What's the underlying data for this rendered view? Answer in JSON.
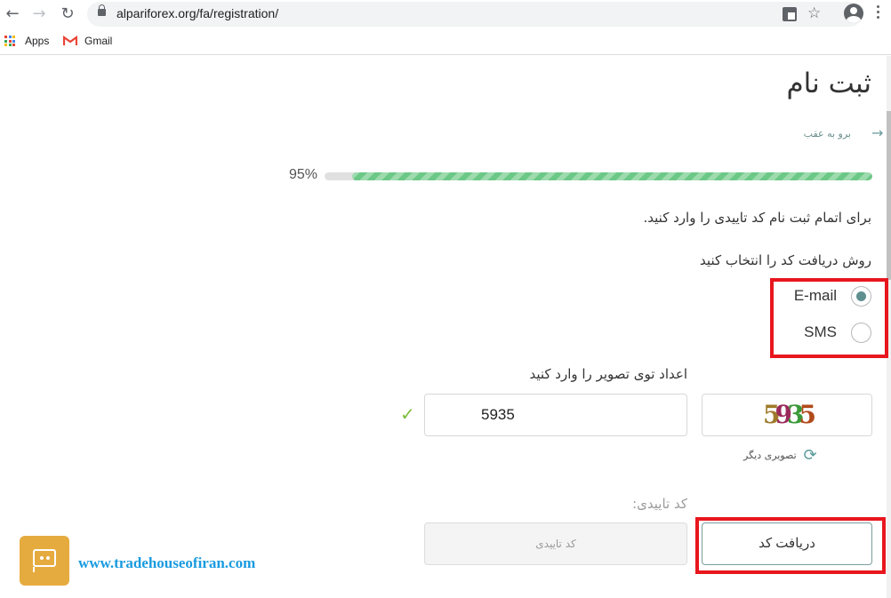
{
  "browser": {
    "url": "alpariforex.org/fa/registration/",
    "bookmarks": [
      {
        "label": "Apps",
        "icon": "apps-grid-icon"
      },
      {
        "label": "Gmail",
        "icon": "gmail-icon"
      }
    ],
    "icons": {
      "back": "←",
      "forward": "→",
      "reload": "↻",
      "star": "☆"
    }
  },
  "page": {
    "title": "ثبت نام",
    "back_link": "برو به عقب",
    "back_arrow": "→",
    "progress": {
      "label": "95%",
      "percent": 95,
      "colors": {
        "stripe_dark": "#6cc886",
        "stripe_light": "#9ddbae",
        "track": "#e0e0e0"
      }
    },
    "instruction": "برای اتمام ثبت نام کد تاییدی را وارد کنید.",
    "method_label": "روش دریافت کد را انتخاب کنید",
    "methods": [
      {
        "label": "E-mail",
        "checked": true
      },
      {
        "label": "SMS",
        "checked": false
      }
    ],
    "captcha": {
      "label": "اعداد توی تصویر را وارد کنید",
      "input_value": "5935",
      "valid_icon": "✓",
      "image_digits": [
        {
          "char": "5",
          "color": "#a07a2a"
        },
        {
          "char": "9",
          "color": "#9a2a5a"
        },
        {
          "char": "3",
          "color": "#3a9a3a"
        },
        {
          "char": "5",
          "color": "#b04a1a"
        }
      ],
      "refresh_label": "تصویری دیگر",
      "refresh_icon": "⟳"
    },
    "verification": {
      "label": "کد تاییدی:",
      "placeholder": "کد تاییدی",
      "get_code_button": "دریافت کد"
    }
  },
  "overlay": {
    "watermark": "www.tradehouseofiran.com",
    "highlight_color": "#e8161d",
    "chat_color": "#e6ab3e"
  }
}
